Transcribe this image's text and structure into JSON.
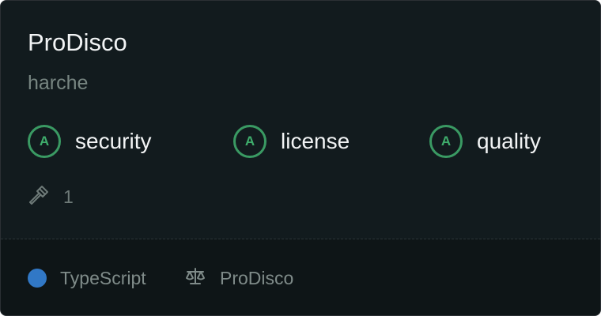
{
  "repo": {
    "name": "ProDisco",
    "owner": "harche"
  },
  "scores": [
    {
      "grade": "A",
      "label": "security"
    },
    {
      "grade": "A",
      "label": "license"
    },
    {
      "grade": "A",
      "label": "quality"
    }
  ],
  "tools": {
    "icon": "hammer-icon",
    "count": "1"
  },
  "footer": {
    "language": "TypeScript",
    "language_color": "#3178c6",
    "license_icon": "scale-icon",
    "license": "ProDisco"
  },
  "colors": {
    "grade_accent": "#3a9a63",
    "card_background": "#111a1d"
  }
}
